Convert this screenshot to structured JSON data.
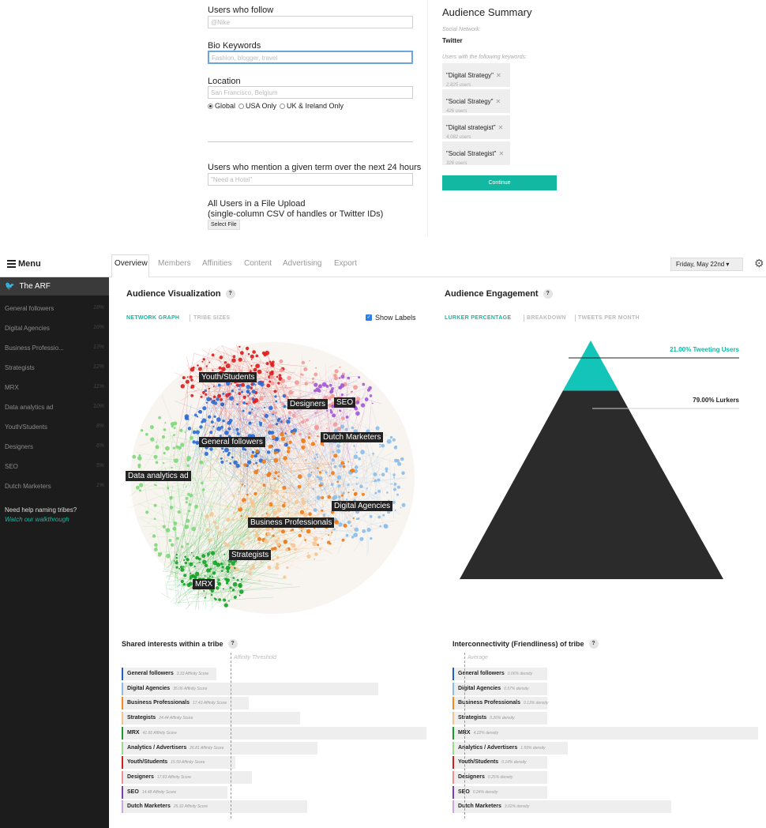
{
  "form": {
    "follow_label": "Users who follow",
    "follow_placeholder": "@Nike",
    "bio_label": "Bio Keywords",
    "bio_placeholder": "Fashion, blogger, travel",
    "location_label": "Location",
    "location_placeholder": "San Francisco, Belgium",
    "radios": [
      {
        "label": "Global",
        "selected": true
      },
      {
        "label": "USA Only",
        "selected": false
      },
      {
        "label": "UK & Ireland Only",
        "selected": false
      }
    ],
    "mention_label": "Users who mention a given term over the next 24 hours",
    "mention_placeholder": "\"Need a Hotel\"",
    "upload_label_1": "All Users in a File Upload",
    "upload_label_2": "(single-column CSV of handles or Twitter IDs)",
    "select_file": "Select File"
  },
  "summary": {
    "title": "Audience Summary",
    "network_label": "Social Network:",
    "network_value": "Twitter",
    "keywords_label": "Users with the following keywords:",
    "keywords": [
      {
        "name": "\"Digital Strategy\"",
        "count": "2,825 users"
      },
      {
        "name": "\"Social Strategy\"",
        "count": "426 users"
      },
      {
        "name": "\"Digital strategist\"",
        "count": "4,082 users"
      },
      {
        "name": "\"Social Strategist\"",
        "count": "326 users"
      }
    ],
    "continue": "Continue"
  },
  "sidebar": {
    "menu": "Menu",
    "account": "The ARF",
    "items": [
      {
        "label": "General followers",
        "pct": "18%"
      },
      {
        "label": "Digital Agencies",
        "pct": "16%"
      },
      {
        "label": "Business Professio...",
        "pct": "13%"
      },
      {
        "label": "Strategists",
        "pct": "12%"
      },
      {
        "label": "MRX",
        "pct": "11%"
      },
      {
        "label": "Data analytics ad",
        "pct": "10%"
      },
      {
        "label": "Youth/Students",
        "pct": "8%"
      },
      {
        "label": "Designers",
        "pct": "6%"
      },
      {
        "label": "SEO",
        "pct": "5%"
      },
      {
        "label": "Dutch Marketers",
        "pct": "1%"
      }
    ],
    "help": "Need help naming tribes?",
    "walkthrough": "Watch our walkthrough"
  },
  "nav": {
    "tabs": [
      "Overview",
      "Members",
      "Affinities",
      "Content",
      "Advertising",
      "Export"
    ],
    "date": "Friday, May 22nd ▾"
  },
  "viz": {
    "title": "Audience Visualization",
    "q": "?",
    "subtabs": [
      "NETWORK GRAPH",
      "TRIBE SIZES"
    ],
    "show_labels": "Show Labels",
    "labels": {
      "youth": "Youth/Students",
      "designers": "Designers",
      "seo": "SEO",
      "dutch": "Dutch Marketers",
      "general": "General followers",
      "data": "Data analytics ad",
      "digital": "Digital Agencies",
      "business": "Business Professionals",
      "strategists": "Strategists",
      "mrx": "MRX"
    }
  },
  "engagement": {
    "title": "Audience Engagement",
    "q": "?",
    "subtabs": [
      "LURKER PERCENTAGE",
      "BREAKDOWN",
      "TWEETS PER MONTH"
    ],
    "tweeting_label": "21.00% Tweeting Users",
    "lurkers_label": "79.00% Lurkers",
    "tweeting_pct": 21,
    "lurkers_pct": 79,
    "teal": "#13c4b8",
    "dark": "#2b2b2b"
  },
  "shared": {
    "title": "Shared interests within a tribe",
    "q": "?",
    "threshold": "Affinity Threshold",
    "rows": [
      {
        "name": "General followers",
        "score": "3.33 Affinity Score",
        "value": 3.33,
        "color": "#1f5fbf"
      },
      {
        "name": "Digital Agencies",
        "score": "35.06 Affinity Score",
        "value": 35.06,
        "color": "#8fb8e8"
      },
      {
        "name": "Business Professionals",
        "score": "17.43 Affinity Score",
        "value": 17.43,
        "color": "#f08a1c"
      },
      {
        "name": "Strategists",
        "score": "24.44 Affinity Score",
        "value": 24.44,
        "color": "#f6c08a"
      },
      {
        "name": "MRX",
        "score": "41.66 Affinity Score",
        "value": 41.66,
        "color": "#1a9a2a"
      },
      {
        "name": "Analytics / Advertisers",
        "score": "26.81 Affinity Score",
        "value": 26.81,
        "color": "#9ad88c"
      },
      {
        "name": "Youth/Students",
        "score": "15.59 Affinity Score",
        "value": 15.59,
        "color": "#cc1f1f"
      },
      {
        "name": "Designers",
        "score": "17.83 Affinity Score",
        "value": 17.83,
        "color": "#f0908e"
      },
      {
        "name": "SEO",
        "score": "14.48 Affinity Score",
        "value": 14.48,
        "color": "#7a3fb0"
      },
      {
        "name": "Dutch Marketers",
        "score": "25.32 Affinity Score",
        "value": 25.32,
        "color": "#c8a8e0"
      }
    ]
  },
  "inter": {
    "title": "Interconnectivity (Friendliness) of tribe",
    "q": "?",
    "average": "Average",
    "rows": [
      {
        "name": "General followers",
        "score": "0.06% density",
        "value": 0.06,
        "color": "#1f5fbf"
      },
      {
        "name": "Digital Agencies",
        "score": "0.57% density",
        "value": 0.57,
        "color": "#8fb8e8"
      },
      {
        "name": "Business Professionals",
        "score": "0.13% density",
        "value": 0.13,
        "color": "#f08a1c"
      },
      {
        "name": "Strategists",
        "score": "0.26% density",
        "value": 0.26,
        "color": "#f6c08a"
      },
      {
        "name": "MRX",
        "score": "4.22% density",
        "value": 4.22,
        "color": "#1a9a2a"
      },
      {
        "name": "Analytics / Advertisers",
        "score": "1.59% density",
        "value": 1.59,
        "color": "#9ad88c"
      },
      {
        "name": "Youth/Students",
        "score": "0.14% density",
        "value": 0.14,
        "color": "#cc1f1f"
      },
      {
        "name": "Designers",
        "score": "0.25% density",
        "value": 0.25,
        "color": "#f0908e"
      },
      {
        "name": "SEO",
        "score": "0.24% density",
        "value": 0.24,
        "color": "#7a3fb0"
      },
      {
        "name": "Dutch Marketers",
        "score": "3.02% density",
        "value": 3.02,
        "color": "#c8a8e0"
      }
    ]
  }
}
